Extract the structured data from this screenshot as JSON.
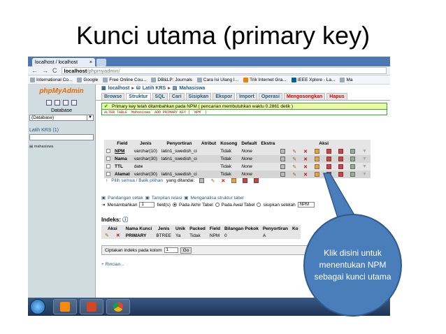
{
  "slide": {
    "title": "Kunci utama (primary key)"
  },
  "browser": {
    "tab_title": "localhost / localhost",
    "url_host": "localhost",
    "url_path": "/phpmyadmin/",
    "bookmarks": [
      "International Co...",
      "Google",
      "Free Online Cou...",
      "DB&LP: Journals",
      "Cara Isi Ulang I...",
      "Trik Internet Gra...",
      "IEEE Xplore - La...",
      "Ma"
    ]
  },
  "sidebar": {
    "logo": "phpMyAdmin",
    "database_label": "Database",
    "database_select": "(Database)",
    "db_link": "Latih KRS (1)",
    "table_item": "mahasiswa"
  },
  "breadcrumb": [
    "localhost",
    "Latih KRS",
    "Mahasiswa"
  ],
  "tabs": [
    "Browse",
    "Struktur",
    "SQL",
    "Cari",
    "Sisipkan",
    "Ekspor",
    "Import",
    "Operasi",
    "Mengosongkan",
    "Hapus"
  ],
  "message": {
    "success": "Primary key telah ditambahkan pada NPM ( pencarian membutuhkan waktu 0.2861 detik )",
    "sql": "ALTER TABLE `Mahasiswa` ADD PRIMARY KEY ( `NPM` )"
  },
  "structure": {
    "headers": [
      "Field",
      "Jenis",
      "Penyortiran",
      "Atribut",
      "Kosong",
      "Default",
      "Ekstra",
      "Aksi"
    ],
    "rows": [
      {
        "field": "NPM",
        "type": "varchar(10)",
        "collation": "latin1_swedish_ci",
        "attr": "",
        "null": "Tidak",
        "default": "None",
        "extra": ""
      },
      {
        "field": "Nama",
        "type": "varchar(30)",
        "collation": "latin1_swedish_ci",
        "attr": "",
        "null": "Tidak",
        "default": "None",
        "extra": ""
      },
      {
        "field": "TTL",
        "type": "date",
        "collation": "",
        "attr": "",
        "null": "Tidak",
        "default": "None",
        "extra": ""
      },
      {
        "field": "Alamat",
        "type": "varchar(30)",
        "collation": "latin1_swedish_ci",
        "attr": "",
        "null": "Tidak",
        "default": "None",
        "extra": ""
      }
    ],
    "select_all": "Pilih semua / Balik pilihan",
    "with_selected": "yang ditandai:"
  },
  "print_row": {
    "print": "Pandangan cetak",
    "relations": "Tampilan relasi",
    "analyze": "Menganalisa struktur tabel"
  },
  "add_row": {
    "label": "Menambahkan",
    "count": "1",
    "fields": "field(s)",
    "at_end": "Pada Akhir Tabel",
    "at_start": "Pada Awal Tabel",
    "after": "sisipkan setelah",
    "after_field": "NPM"
  },
  "indexes": {
    "title": "Indeks:",
    "headers": [
      "Aksi",
      "Nama Kunci",
      "Jenis",
      "Unik",
      "Packed",
      "Field",
      "Bilangan Pokok",
      "Penyortiran",
      "Ko"
    ],
    "row": {
      "name": "PRIMARY",
      "type": "BTREE",
      "unique": "Ya",
      "packed": "Tidak",
      "field": "NPM",
      "cardinality": "0",
      "collation": "A"
    },
    "create_label": "Ciptakan indeks pada kolom",
    "create_count": "1",
    "go": "Go",
    "details": "+ Rincian..."
  },
  "callout": {
    "text": "Klik disini untuk menentukan NPM sebagai kunci utama"
  },
  "colors": {
    "accent": "#235a81",
    "callout": "#4a7ebb",
    "logo": "#e56b00"
  }
}
